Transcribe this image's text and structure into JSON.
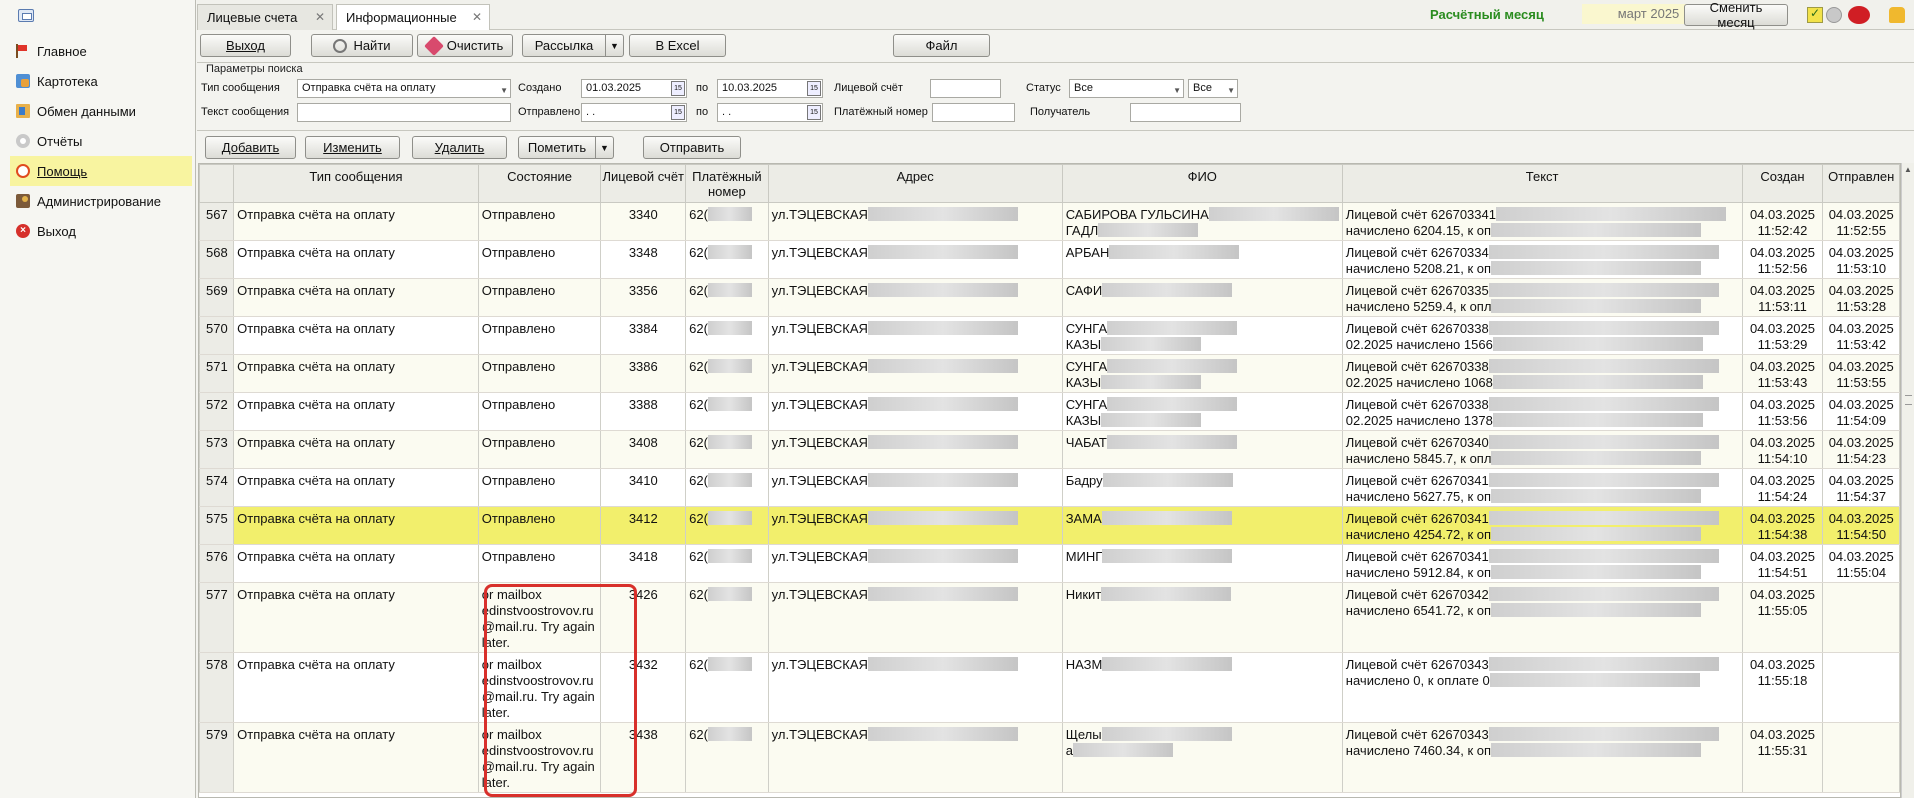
{
  "sidebar": {
    "items": [
      {
        "label": "Главное",
        "icon": "flag-icon"
      },
      {
        "label": "Картотека",
        "icon": "card-file-icon"
      },
      {
        "label": "Обмен данными",
        "icon": "data-exchange-icon"
      },
      {
        "label": "Отчёты",
        "icon": "reports-icon"
      },
      {
        "label": "Помощь",
        "icon": "help-icon",
        "active": true
      },
      {
        "label": "Администрирование",
        "icon": "admin-icon"
      },
      {
        "label": "Выход",
        "icon": "exit-icon"
      }
    ]
  },
  "tabs": [
    {
      "label": "Лицевые счета",
      "close": "✕"
    },
    {
      "label": "Информационные",
      "close": "✕",
      "active": true
    }
  ],
  "header": {
    "month_label": "Расчётный месяц",
    "month_value": "март 2025",
    "change_month": "Сменить месяц"
  },
  "toolbar": {
    "exit": "Выход",
    "find": "Найти",
    "clear": "Очистить",
    "mailing": "Рассылка",
    "excel": "В Excel",
    "file": "Файл"
  },
  "params": {
    "title": "Параметры поиска",
    "msg_type_label": "Тип сообщения",
    "msg_type_value": "Отправка счёта на оплату",
    "created_label": "Создано",
    "created_from": "01.03.2025",
    "to_label": "по",
    "created_to": "10.03.2025",
    "account_label": "Лицевой счёт",
    "status_label": "Статус",
    "status_value": "Все",
    "status_value2": "Все",
    "text_label": "Текст сообщения",
    "sent_label": "Отправлено",
    "sent_from": ". .",
    "sent_to": ". .",
    "payment_label": "Платёжный номер",
    "recipient_label": "Получатель"
  },
  "actions": {
    "add": "Добавить",
    "edit": "Изменить",
    "delete": "Удалить",
    "mark": "Пометить",
    "send": "Отправить"
  },
  "grid": {
    "columns": [
      "Тип сообщения",
      "Состояние",
      "Лицевой счёт",
      "Платёжный номер",
      "Адрес",
      "ФИО",
      "Текст",
      "Создан",
      "Отправлен"
    ],
    "rows": [
      {
        "n": "567",
        "type": "Отправка счёта на оплату",
        "state": "Отправлено",
        "acc": "3340",
        "pay": "62(",
        "addr": "ул.ТЭЦЕВСКАЯ",
        "fio1": "САБИРОВА ГУЛЬСИНА",
        "fio2": "ГАДЛ",
        "text1": "Лицевой счёт 626703341",
        "text2": "начислено 6204.15, к оп",
        "cd": "04.03.2025",
        "ct": "11:52:42",
        "sd": "04.03.2025",
        "st": "11:52:55"
      },
      {
        "n": "568",
        "type": "Отправка счёта на оплату",
        "state": "Отправлено",
        "acc": "3348",
        "pay": "62(",
        "addr": "ул.ТЭЦЕВСКАЯ",
        "fio1": "АРБАН",
        "fio2": "",
        "text1": "Лицевой счёт 62670334",
        "text2": "начислено 5208.21, к оп",
        "cd": "04.03.2025",
        "ct": "11:52:56",
        "sd": "04.03.2025",
        "st": "11:53:10"
      },
      {
        "n": "569",
        "type": "Отправка счёта на оплату",
        "state": "Отправлено",
        "acc": "3356",
        "pay": "62(",
        "addr": "ул.ТЭЦЕВСКАЯ",
        "fio1": "САФИ",
        "fio2": "",
        "text1": "Лицевой счёт 62670335",
        "text2": "начислено 5259.4, к опл",
        "cd": "04.03.2025",
        "ct": "11:53:11",
        "sd": "04.03.2025",
        "st": "11:53:28"
      },
      {
        "n": "570",
        "type": "Отправка счёта на оплату",
        "state": "Отправлено",
        "acc": "3384",
        "pay": "62(",
        "addr": "ул.ТЭЦЕВСКАЯ",
        "fio1": "СУНГА",
        "fio2": "КАЗЫ",
        "text1": "Лицевой счёт 62670338",
        "text2": "02.2025 начислено 1566",
        "cd": "04.03.2025",
        "ct": "11:53:29",
        "sd": "04.03.2025",
        "st": "11:53:42"
      },
      {
        "n": "571",
        "type": "Отправка счёта на оплату",
        "state": "Отправлено",
        "acc": "3386",
        "pay": "62(",
        "addr": "ул.ТЭЦЕВСКАЯ",
        "fio1": "СУНГА",
        "fio2": "КАЗЫ",
        "text1": "Лицевой счёт 62670338",
        "text2": "02.2025 начислено 1068",
        "cd": "04.03.2025",
        "ct": "11:53:43",
        "sd": "04.03.2025",
        "st": "11:53:55"
      },
      {
        "n": "572",
        "type": "Отправка счёта на оплату",
        "state": "Отправлено",
        "acc": "3388",
        "pay": "62(",
        "addr": "ул.ТЭЦЕВСКАЯ",
        "fio1": "СУНГА",
        "fio2": "КАЗЫ",
        "text1": "Лицевой счёт 62670338",
        "text2": "02.2025 начислено 1378",
        "cd": "04.03.2025",
        "ct": "11:53:56",
        "sd": "04.03.2025",
        "st": "11:54:09"
      },
      {
        "n": "573",
        "type": "Отправка счёта на оплату",
        "state": "Отправлено",
        "acc": "3408",
        "pay": "62(",
        "addr": "ул.ТЭЦЕВСКАЯ",
        "fio1": "ЧАБАТ",
        "fio2": "",
        "text1": "Лицевой счёт 62670340",
        "text2": "начислено 5845.7, к опл",
        "cd": "04.03.2025",
        "ct": "11:54:10",
        "sd": "04.03.2025",
        "st": "11:54:23"
      },
      {
        "n": "574",
        "type": "Отправка счёта на оплату",
        "state": "Отправлено",
        "acc": "3410",
        "pay": "62(",
        "addr": "ул.ТЭЦЕВСКАЯ",
        "fio1": "Бадру",
        "fio2": "",
        "text1": "Лицевой счёт 62670341",
        "text2": "начислено 5627.75, к оп",
        "cd": "04.03.2025",
        "ct": "11:54:24",
        "sd": "04.03.2025",
        "st": "11:54:37"
      },
      {
        "n": "575",
        "type": "Отправка счёта на оплату",
        "state": "Отправлено",
        "acc": "3412",
        "pay": "62(",
        "addr": "ул.ТЭЦЕВСКАЯ",
        "fio1": "ЗАМА",
        "fio2": "",
        "text1": "Лицевой счёт 62670341",
        "text2": "начислено 4254.72, к оп",
        "cd": "04.03.2025",
        "ct": "11:54:38",
        "sd": "04.03.2025",
        "st": "11:54:50",
        "selected": true
      },
      {
        "n": "576",
        "type": "Отправка счёта на оплату",
        "state": "Отправлено",
        "acc": "3418",
        "pay": "62(",
        "addr": "ул.ТЭЦЕВСКАЯ",
        "fio1": "МИНГ",
        "fio2": "",
        "text1": "Лицевой счёт 62670341",
        "text2": "начислено 5912.84, к оп",
        "cd": "04.03.2025",
        "ct": "11:54:51",
        "sd": "04.03.2025",
        "st": "11:55:04"
      },
      {
        "n": "577",
        "type": "Отправка счёта на оплату",
        "state": "or mailbox edinstvoostrovov.ru @mail.ru. Try again later.",
        "acc": "3426",
        "pay": "62(",
        "addr": "ул.ТЭЦЕВСКАЯ",
        "fio1": "Никит",
        "fio2": "",
        "text1": "Лицевой счёт 62670342",
        "text2": "начислено 6541.72, к оп",
        "cd": "04.03.2025",
        "ct": "11:55:05",
        "sd": "",
        "st": "",
        "tall": true
      },
      {
        "n": "578",
        "type": "Отправка счёта на оплату",
        "state": "or mailbox edinstvoostrovov.ru @mail.ru. Try again later.",
        "acc": "3432",
        "pay": "62(",
        "addr": "ул.ТЭЦЕВСКАЯ",
        "fio1": "НАЗМ",
        "fio2": "",
        "text1": "Лицевой счёт 62670343",
        "text2": "начислено 0, к оплате 0",
        "cd": "04.03.2025",
        "ct": "11:55:18",
        "sd": "",
        "st": "",
        "tall": true
      },
      {
        "n": "579",
        "type": "Отправка счёта на оплату",
        "state": "or mailbox edinstvoostrovov.ru @mail.ru. Try again later.",
        "acc": "3438",
        "pay": "62(",
        "addr": "ул.ТЭЦЕВСКАЯ",
        "fio1": "Щелы",
        "fio2": "а",
        "text1": "Лицевой счёт 62670343",
        "text2": "начислено 7460.34, к оп",
        "cd": "04.03.2025",
        "ct": "11:55:31",
        "sd": "",
        "st": "",
        "tall": true
      }
    ]
  },
  "colors": {
    "accent_green": "#2a8c1f",
    "selected_row": "#f2ef6c",
    "sidebar_active": "#f8f4a0",
    "highlight_frame": "#d8302b"
  }
}
